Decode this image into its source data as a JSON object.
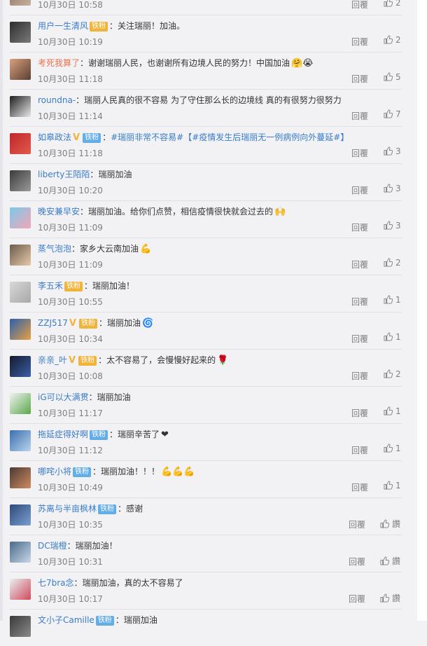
{
  "comments": [
    {
      "user": "",
      "user_color": "blue",
      "badges": [],
      "text": "",
      "emoji": "",
      "time": "10月30日 10:58",
      "reply": "回覆",
      "likes": "2",
      "avatar": [
        "#8a6d5c",
        "#c7b3a0"
      ]
    },
    {
      "user": "用户一生清风",
      "user_color": "blue",
      "badges": [
        {
          "label": "铁粉",
          "style": "gold"
        }
      ],
      "text": "关注瑞丽！加油。",
      "emoji": "",
      "time": "10月30日 10:19",
      "reply": "回覆",
      "likes": "2",
      "avatar": [
        "#2d2d2d",
        "#7a7a7a"
      ]
    },
    {
      "user": "考死我算了",
      "user_color": "orange",
      "badges": [],
      "text": "谢谢瑞丽人民，也谢谢所有边境人民的努力！中国加油",
      "emoji": "🤗😭",
      "time": "10月30日 11:18",
      "reply": "回覆",
      "likes": "5",
      "avatar": [
        "#d9a07d",
        "#5a3e33"
      ]
    },
    {
      "user": "roundna-",
      "user_color": "blue",
      "badges": [],
      "text": "瑞丽人民真的很不容易 为了守住那么长的边境线 真的有很努力很努力",
      "emoji": "",
      "time": "10月30日 11:14",
      "reply": "回覆",
      "likes": "7",
      "avatar": [
        "#1e1e1e",
        "#e8e8e8"
      ]
    },
    {
      "user": "如皋政法",
      "user_color": "blue",
      "badges": [
        {
          "label": "铁粉",
          "style": "blue"
        }
      ],
      "verified": true,
      "text": "#瑞丽非常不容易#【#疫情发生后瑞丽无一例病例向外蔓延#】",
      "text_link": true,
      "emoji": "",
      "time": "10月30日 11:18",
      "reply": "回覆",
      "likes": "3",
      "avatar": [
        "#c0262b",
        "#e05a4a"
      ]
    },
    {
      "user": "liberty王陌陌",
      "user_color": "blue",
      "badges": [],
      "text": "瑞丽加油",
      "emoji": "",
      "time": "10月30日 10:20",
      "reply": "回覆",
      "likes": "3",
      "avatar": [
        "#3b3b3b",
        "#9a9a9a"
      ]
    },
    {
      "user": "晚安兼早安",
      "user_color": "blue",
      "badges": [],
      "text": "瑞丽加油。给你们点赞，相信疫情很快就会过去的",
      "emoji": "🙌",
      "time": "10月30日 11:09",
      "reply": "回覆",
      "likes": "3",
      "avatar": [
        "#7cc8e8",
        "#f3a6b8"
      ]
    },
    {
      "user": "蒸气泡泡",
      "user_color": "blue",
      "badges": [],
      "text": "家乡大云南加油",
      "emoji": "💪",
      "time": "10月30日 11:09",
      "reply": "回覆",
      "likes": "2",
      "avatar": [
        "#6b5b4e",
        "#e8c9a8"
      ]
    },
    {
      "user": "李五禾",
      "user_color": "blue",
      "badges": [
        {
          "label": "铁粉",
          "style": "gold"
        }
      ],
      "text": "瑞丽加油！",
      "emoji": "",
      "time": "10月30日 10:55",
      "reply": "回覆",
      "likes": "1",
      "avatar": [
        "#d8d8d8",
        "#a8a8a8"
      ]
    },
    {
      "user": "ZZJ517",
      "user_color": "blue",
      "badges": [
        {
          "label": "铁粉",
          "style": "gold"
        }
      ],
      "verified": true,
      "text": "瑞丽加油",
      "emoji": "🌀",
      "time": "10月30日 10:34",
      "reply": "回覆",
      "likes": "1",
      "avatar": [
        "#2a5fb0",
        "#e8a040"
      ]
    },
    {
      "user": "亲亲_叶",
      "user_color": "blue",
      "badges": [
        {
          "label": "铁粉",
          "style": "gold"
        }
      ],
      "verified": true,
      "text": "太不容易了，会慢慢好起来的",
      "emoji": "🌹",
      "time": "10月30日 10:08",
      "reply": "回覆",
      "likes": "2",
      "avatar": [
        "#141a2c",
        "#3a5fa8"
      ]
    },
    {
      "user": "iG可以大满贯",
      "user_color": "blue",
      "badges": [],
      "text": "瑞丽加油",
      "emoji": "",
      "time": "10月30日 11:17",
      "reply": "回覆",
      "likes": "1",
      "avatar": [
        "#f2f2f2",
        "#5aa84a"
      ]
    },
    {
      "user": "拖延症得好啊",
      "user_color": "blue",
      "badges": [
        {
          "label": "铁粉",
          "style": "blue"
        }
      ],
      "text": "瑞丽辛苦了",
      "emoji": "❤",
      "time": "10月30日 11:12",
      "reply": "回覆",
      "likes": "1",
      "avatar": [
        "#3a6fb0",
        "#b8d4ec"
      ]
    },
    {
      "user": "哪咤小将",
      "user_color": "blue",
      "badges": [
        {
          "label": "铁粉",
          "style": "blue"
        }
      ],
      "text": "瑞丽加油！！！",
      "emoji": "💪💪💪",
      "time": "10月30日 10:49",
      "reply": "回覆",
      "likes": "1",
      "avatar": [
        "#4a3a34",
        "#d08a60"
      ]
    },
    {
      "user": "苏离与半亩枫林",
      "user_color": "blue",
      "badges": [
        {
          "label": "铁粉",
          "style": "blue"
        }
      ],
      "text": "感谢",
      "emoji": "",
      "time": "10月30日 10:35",
      "reply": "回覆",
      "likes": "讚",
      "avatar": [
        "#2d4a7a",
        "#7aa0d0"
      ],
      "wide": true
    },
    {
      "user": "DC瑞橙",
      "user_color": "blue",
      "badges": [],
      "text": "瑞丽加油！",
      "emoji": "",
      "time": "10月30日 10:31",
      "reply": "回覆",
      "likes": "讚",
      "avatar": [
        "#4a6a8a",
        "#c8d8e8"
      ],
      "wide": true
    },
    {
      "user": "七7bra念",
      "user_color": "blue",
      "badges": [],
      "text": "瑞丽加油，真的太不容易了",
      "emoji": "",
      "time": "10月30日 10:17",
      "reply": "回覆",
      "likes": "讚",
      "avatar": [
        "#e8f0f4",
        "#d04a5a"
      ],
      "wide": true
    },
    {
      "user": "文小子Camille",
      "user_color": "blue",
      "badges": [
        {
          "label": "铁粉",
          "style": "blue"
        }
      ],
      "text": "瑞丽加油",
      "emoji": "",
      "time": "",
      "reply": "",
      "likes": "",
      "avatar": [
        "#3a3a3a",
        "#8a8a8a"
      ],
      "wide": true
    }
  ]
}
